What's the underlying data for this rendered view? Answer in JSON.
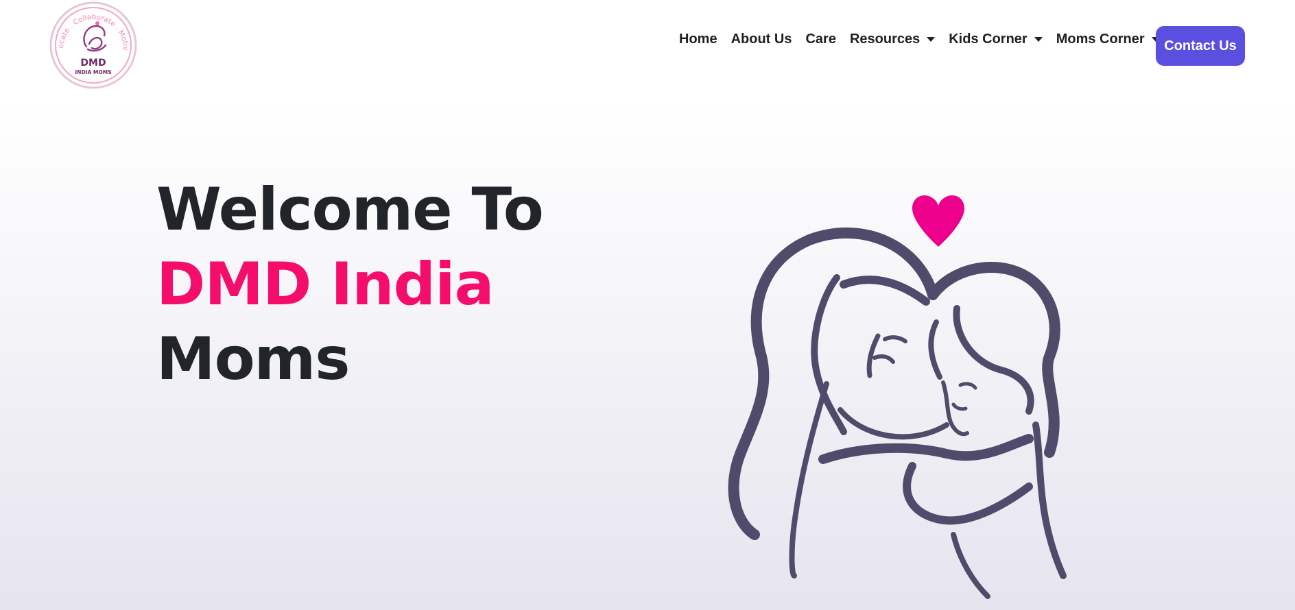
{
  "brand": {
    "logo_ring_text": "Advocate . Collaborate . Motivate",
    "logo_title": "DMD",
    "logo_subtitle": "INDIA MOMS",
    "logo_icon": "mother-child-logo-icon"
  },
  "nav": {
    "items": [
      {
        "label": "Home",
        "dropdown": false
      },
      {
        "label": "About Us",
        "dropdown": false
      },
      {
        "label": "Care",
        "dropdown": false
      },
      {
        "label": "Resources",
        "dropdown": true
      },
      {
        "label": "Kids Corner",
        "dropdown": true
      },
      {
        "label": "Moms Corner",
        "dropdown": true
      }
    ],
    "contact_label": "Contact Us"
  },
  "hero": {
    "line1": "Welcome To",
    "line2": "DMD India",
    "line3": "Moms",
    "illustration": "mother-kissing-child-illustration"
  },
  "colors": {
    "accent_pink": "#f50d6b",
    "button_purple": "#5b4fe0",
    "illustration_stroke": "#4f4b6b",
    "heart": "#ec008c"
  }
}
